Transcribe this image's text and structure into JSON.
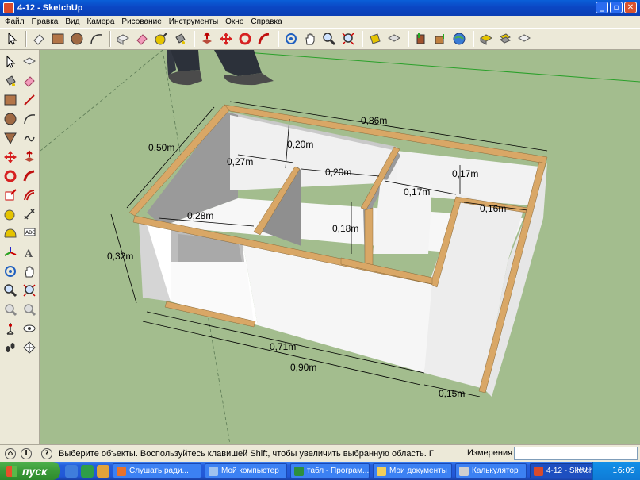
{
  "window": {
    "title": "4-12 - SketchUp"
  },
  "menu": [
    "Файл",
    "Правка",
    "Вид",
    "Камера",
    "Рисование",
    "Инструменты",
    "Окно",
    "Справка"
  ],
  "toolbar": {
    "tools": [
      "select-tool",
      "eraser-tool",
      "rectangle-tool",
      "circle-tool",
      "arc-tool",
      "make-component-tool",
      "paint-bucket-tool",
      "pushpull-tool",
      "move-tool",
      "rotate-tool",
      "follow-me-tool",
      "orbit-tool",
      "pan-tool",
      "zoom-tool",
      "zoom-extents-tool",
      "tape-measure-tool",
      "section-tool",
      "get-models-tool",
      "share-model-tool",
      "google-earth-tool",
      "warehouse-tool",
      "components-tool"
    ]
  },
  "dimensions": {
    "total_length": "0,86m",
    "depth": "0,50m",
    "inner_27": "0,27m",
    "inner_20a": "0,20m",
    "inner_20b": "0,20m",
    "inner_17a": "0,17m",
    "inner_17b": "0,17m",
    "inner_16": "0,16m",
    "inner_28": "0,28m",
    "inner_18": "0,18m",
    "height": "0,32m",
    "front_71": "0,71m",
    "front_90": "0,90m",
    "side_15": "0,15m"
  },
  "status": {
    "hint": "Выберите объекты. Воспользуйтесь клавишей Shift, чтобы увеличить выбранную область. Г",
    "measure_label": "Измерения",
    "measure_value": ""
  },
  "taskbar": {
    "start": "пуск",
    "tasks": [
      "Слушать ради...",
      "Мой компьютер",
      "табл - Програм...",
      "Мои документы",
      "Калькулятор",
      "4-12 - SketchUp"
    ],
    "language": "RU",
    "clock": "16:09"
  },
  "colors": {
    "viewport": "#a3bd8e",
    "wood": "#d9a766",
    "panel": "#f4f4f4",
    "shadow": "#b7b7b7"
  }
}
